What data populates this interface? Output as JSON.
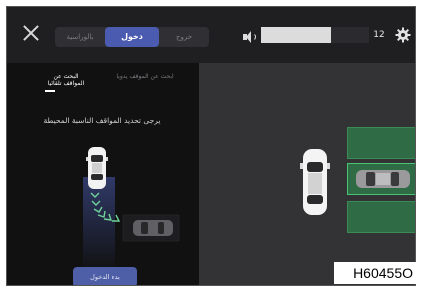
{
  "header": {
    "close_icon": "close-icon",
    "mode_tabs": [
      {
        "label": "بالوراسية",
        "selected": false
      },
      {
        "label": "دخول",
        "selected": true
      },
      {
        "label": "خروج",
        "selected": false
      }
    ],
    "volume": {
      "icon": "speaker-icon",
      "level": 0.65,
      "value": "12"
    },
    "settings_icon": "gear-icon"
  },
  "left_panel": {
    "tabs": [
      {
        "label": "البحث عن المواقف تلقائيا",
        "active": true
      },
      {
        "label": "ابحث عن الموقف يدويا",
        "active": false
      }
    ],
    "prompt": "يرجى تحديد المواقف الناسبة المحيطة",
    "start_button": "بدء الدخول"
  },
  "colors": {
    "accent": "#4a5bb0",
    "slot_green": "#2f6b44",
    "slot_selected_border": "#49c477",
    "trajectory": "#6fd39a"
  },
  "figure_code": "H60455O"
}
